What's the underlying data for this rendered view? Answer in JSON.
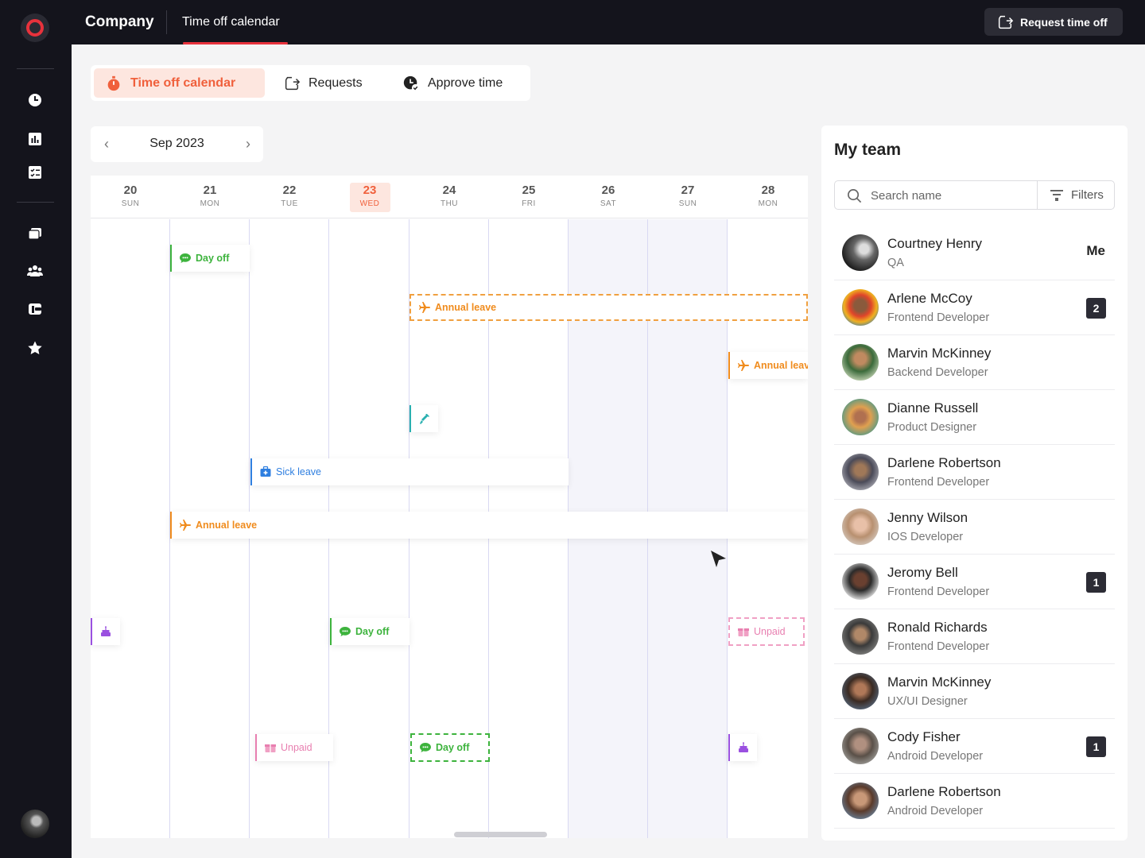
{
  "topbar": {
    "company": "Company",
    "active_tab": "Time off calendar",
    "request_button": "Request time off"
  },
  "subtabs": [
    {
      "label": "Time off calendar",
      "icon": "stopwatch-icon",
      "active": true
    },
    {
      "label": "Requests",
      "icon": "export-icon",
      "active": false
    },
    {
      "label": "Approve time",
      "icon": "clock-check-icon",
      "active": false
    }
  ],
  "month_nav": {
    "label": "Sep 2023"
  },
  "calendar": {
    "days": [
      {
        "num": "20",
        "name": "SUN",
        "weekend": false
      },
      {
        "num": "21",
        "name": "MON",
        "weekend": false
      },
      {
        "num": "22",
        "name": "TUE",
        "weekend": false
      },
      {
        "num": "23",
        "name": "WED",
        "today": true,
        "weekend": false
      },
      {
        "num": "24",
        "name": "THU",
        "weekend": false
      },
      {
        "num": "25",
        "name": "FRI",
        "weekend": false
      },
      {
        "num": "26",
        "name": "SAT",
        "weekend": true
      },
      {
        "num": "27",
        "name": "SUN",
        "weekend": true
      },
      {
        "num": "28",
        "name": "MON",
        "weekend": false
      }
    ],
    "events": {
      "day_off_1": "Day off",
      "annual_leave_1": "Annual leave",
      "annual_leave_2": "Annual leave",
      "sick_leave": "Sick leave",
      "annual_leave_3": "Annual leave",
      "day_off_2": "Day off",
      "unpaid_1": "Unpaid",
      "unpaid_2": "Unpaid",
      "day_off_3": "Day off"
    },
    "colors": {
      "day_off": "#3db33d",
      "annual_leave": "#f08c1e",
      "sick_leave": "#2f7fe0",
      "unpaid": "#e87fb0",
      "birthday": "#9a50e0",
      "vaccine": "#2ab0b0"
    }
  },
  "team": {
    "title": "My team",
    "search_placeholder": "Search name",
    "filters_label": "Filters",
    "members": [
      {
        "name": "Courtney Henry",
        "role": "QA",
        "tag": "Me"
      },
      {
        "name": "Arlene McCoy",
        "role": "Frontend Developer",
        "badge": "2"
      },
      {
        "name": "Marvin McKinney",
        "role": "Backend Developer"
      },
      {
        "name": "Dianne Russell",
        "role": "Product Designer"
      },
      {
        "name": "Darlene Robertson",
        "role": "Frontend Developer"
      },
      {
        "name": "Jenny Wilson",
        "role": "IOS Developer"
      },
      {
        "name": "Jeromy Bell",
        "role": "Frontend Developer",
        "badge": "1"
      },
      {
        "name": "Ronald Richards",
        "role": "Frontend Developer"
      },
      {
        "name": "Marvin McKinney",
        "role": "UX/UI Designer"
      },
      {
        "name": "Cody Fisher",
        "role": "Android Developer",
        "badge": "1"
      },
      {
        "name": "Darlene Robertson",
        "role": "Android Developer"
      }
    ]
  }
}
